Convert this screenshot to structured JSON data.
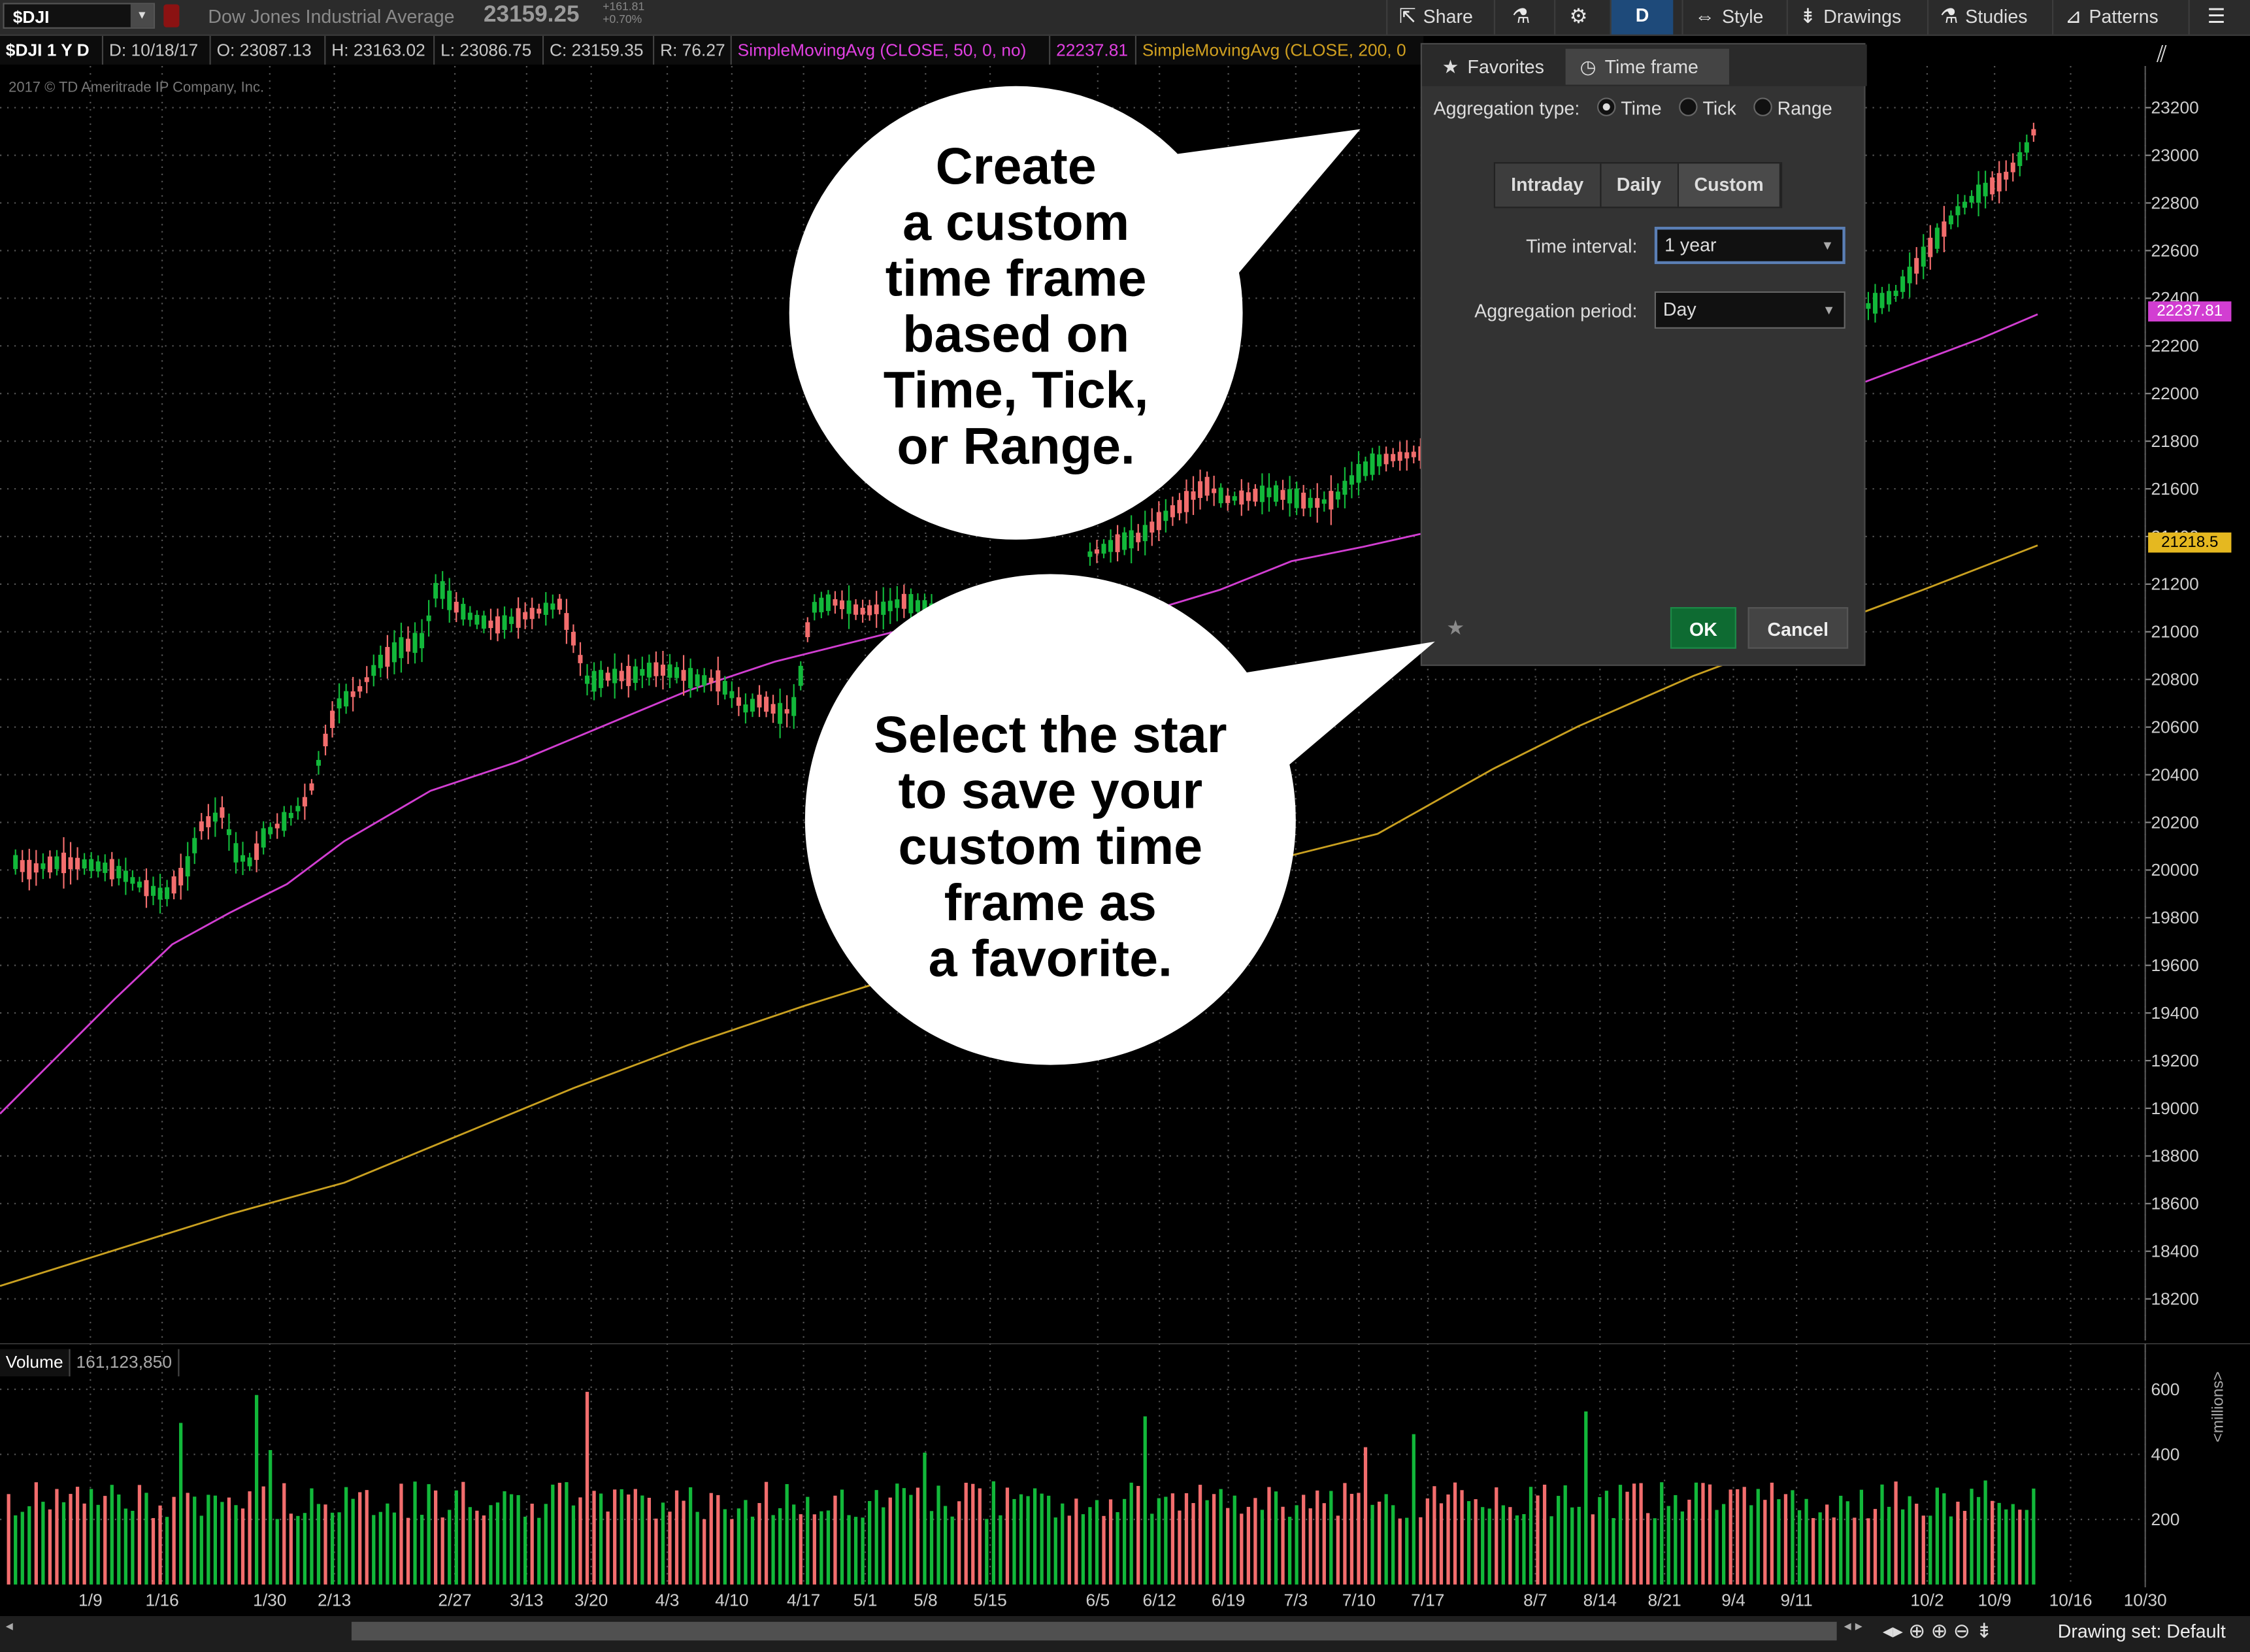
{
  "toolbar": {
    "symbol": "$DJI",
    "description": "Dow Jones Industrial Average",
    "last_price": "23159.25",
    "net_change": "+161.81",
    "pct_change": "+0.70%",
    "share": "Share",
    "period_button": "D",
    "style": "Style",
    "drawings": "Drawings",
    "studies": "Studies",
    "patterns": "Patterns"
  },
  "info": {
    "symbol_period": "$DJI 1 Y D",
    "date": "D: 10/18/17",
    "open": "O: 23087.13",
    "high": "H: 23163.02",
    "low": "L: 23086.75",
    "close": "C: 23159.35",
    "range": "R: 76.27",
    "sma50_label": "SimpleMovingAvg (CLOSE, 50, 0, no)",
    "sma50_value": "22237.81",
    "sma200_label": "SimpleMovingAvg (CLOSE, 200, 0"
  },
  "copyright": "2017 © TD Ameritrade IP Company, Inc.",
  "colors": {
    "up": "#12b83a",
    "down": "#f26d6d",
    "sma50": "#d23ed2",
    "sma200": "#c9a020",
    "grid": "#555555",
    "dialog_bg": "#333333",
    "ok_button": "#0e6b32"
  },
  "price_axis": [
    "23200",
    "23000",
    "22800",
    "22600",
    "22400",
    "22200",
    "22000",
    "21800",
    "21600",
    "21400",
    "21200",
    "21000",
    "20800",
    "20600",
    "20400",
    "20200",
    "20000",
    "19800",
    "19600",
    "19400",
    "19200",
    "19000",
    "18800",
    "18600",
    "18400",
    "18200"
  ],
  "price_tags": {
    "sma50": "22237.81",
    "sma200": "21218.5"
  },
  "volume": {
    "label": "Volume",
    "value": "161,123,850",
    "axis": [
      "600",
      "400",
      "200"
    ],
    "unit": "<millions>"
  },
  "x_axis": [
    "1/9",
    "1/16",
    "1/30",
    "2/13",
    "2/27",
    "3/13",
    "3/20",
    "4/3",
    "4/10",
    "4/17",
    "5/1",
    "5/8",
    "5/15",
    "6/5",
    "6/12",
    "6/19",
    "7/3",
    "7/10",
    "7/17",
    "8/7",
    "8/14",
    "8/21",
    "9/4",
    "9/11",
    "10/2",
    "10/9",
    "10/16",
    "10/30"
  ],
  "dialog": {
    "tab_favorites": "Favorites",
    "tab_timeframe": "Time frame",
    "aggregation_label": "Aggregation type:",
    "agg_time": "Time",
    "agg_tick": "Tick",
    "agg_range": "Range",
    "seg_intraday": "Intraday",
    "seg_daily": "Daily",
    "seg_custom": "Custom",
    "time_interval_label": "Time interval:",
    "time_interval_value": "1 year",
    "agg_period_label": "Aggregation period:",
    "agg_period_value": "Day",
    "ok": "OK",
    "cancel": "Cancel"
  },
  "callouts": {
    "top": [
      "Create",
      "a custom",
      "time frame",
      "based on",
      "Time, Tick,",
      "or Range."
    ],
    "bottom": [
      "Select the star",
      "to save your",
      "custom time",
      "frame as",
      "a favorite."
    ]
  },
  "bottom_bar": {
    "drawing_set": "Drawing set: Default"
  }
}
